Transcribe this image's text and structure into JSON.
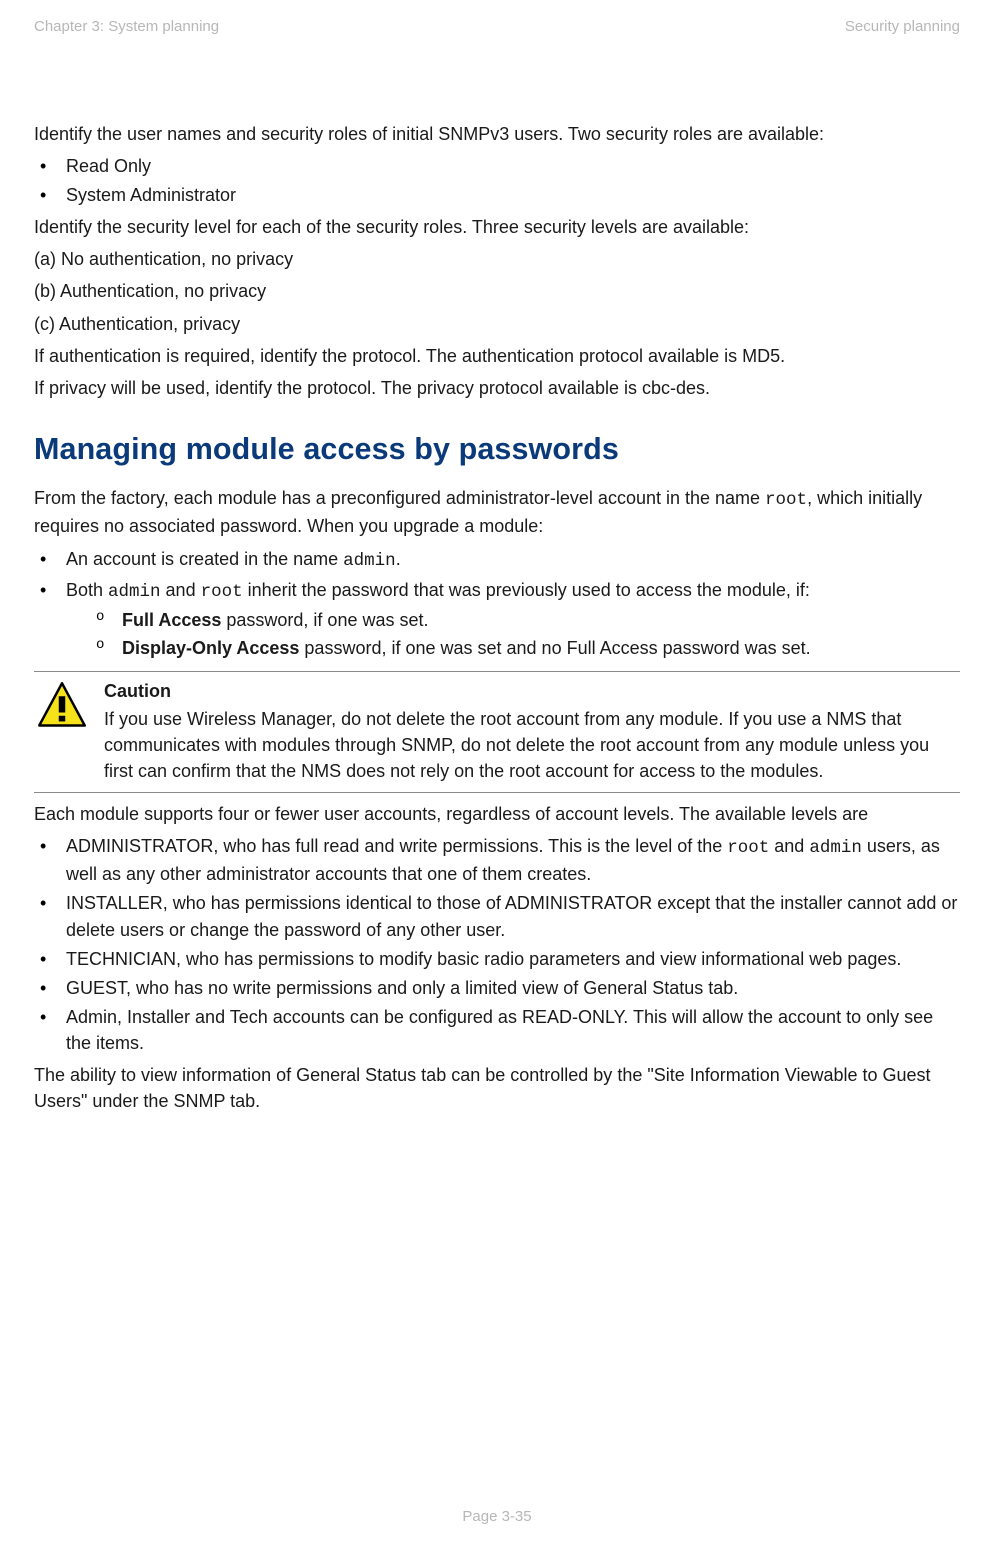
{
  "header": {
    "left": "Chapter 3:  System planning",
    "right": "Security planning"
  },
  "intro_para": "Identify the user names and security roles of initial SNMPv3 users. Two security roles are available:",
  "roles": [
    "Read Only",
    "System Administrator"
  ],
  "sec_level_intro": "Identify the security level for each of the security roles. Three security levels are available:",
  "sec_levels": [
    "(a) No authentication, no privacy",
    "(b) Authentication, no privacy",
    "(c) Authentication, privacy"
  ],
  "auth_proto": "If authentication is required, identify the protocol. The authentication protocol available is MD5.",
  "priv_proto": "If privacy will be used, identify the protocol. The privacy protocol available is cbc-des.",
  "heading": "Managing module access by passwords",
  "from_factory_pre": "From the factory, each module has a preconfigured administrator-level account in the name ",
  "root_code": "root",
  "from_factory_post": ", which initially requires no associated password. When you upgrade a module:",
  "upgrade_bullets": {
    "first_pre": "An account is created in the name ",
    "admin_code": "admin",
    "first_post": ".",
    "second_pre_a": "Both ",
    "second_pre_b": " and ",
    "second_post": " inherit the password that was previously used to access the module, if:",
    "sub": [
      {
        "bold": "Full Access",
        "rest": " password, if one was set."
      },
      {
        "bold": "Display-Only Access",
        "rest": " password, if one was set and no Full Access password was set."
      }
    ]
  },
  "caution": {
    "title": "Caution",
    "body": "If you use Wireless Manager, do not delete the root account from any module. If you use a NMS that communicates with modules through SNMP, do not delete the root account from any module unless you first can confirm that the NMS does not rely on the root account for access to the modules."
  },
  "accounts_intro": "Each module supports four or fewer user accounts, regardless of account levels. The available levels are",
  "account_levels": {
    "admin_pre": "ADMINISTRATOR, who has full read and write permissions. This is the level of the ",
    "admin_mid": " and ",
    "admin_post": " users, as well as any other administrator accounts that one of them creates.",
    "installer": "INSTALLER, who has permissions identical to those of ADMINISTRATOR except that the installer cannot add or delete users or change the password of any other user.",
    "technician": "TECHNICIAN, who has permissions to modify basic radio parameters and view informational web pages.",
    "guest": "GUEST, who has no write permissions and only a limited view of General Status tab.",
    "readonly": "Admin, Installer and Tech accounts can be configured as READ-ONLY. This will allow the account to only see the items."
  },
  "closing": "The ability to view information of General Status tab can be controlled by the \"Site Information Viewable to Guest Users\" under the SNMP tab.",
  "footer": "Page 3-35"
}
